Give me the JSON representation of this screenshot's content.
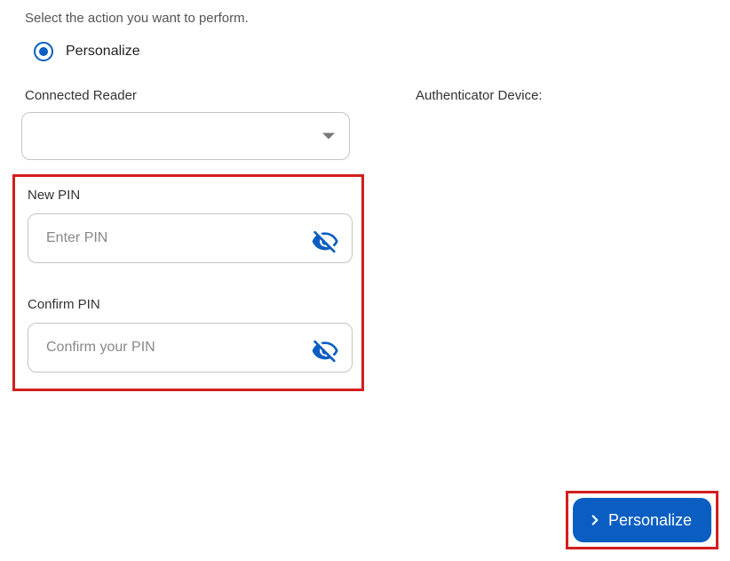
{
  "instruction": "Select the action you want to perform.",
  "radio_option": {
    "label": "Personalize"
  },
  "connected_reader": {
    "label": "Connected Reader",
    "value": ""
  },
  "authenticator_device": {
    "label": "Authenticator Device:"
  },
  "new_pin": {
    "label": "New PIN",
    "placeholder": "Enter PIN",
    "value": ""
  },
  "confirm_pin": {
    "label": "Confirm PIN",
    "placeholder": "Confirm your PIN",
    "value": ""
  },
  "button": {
    "label": "Personalize"
  }
}
